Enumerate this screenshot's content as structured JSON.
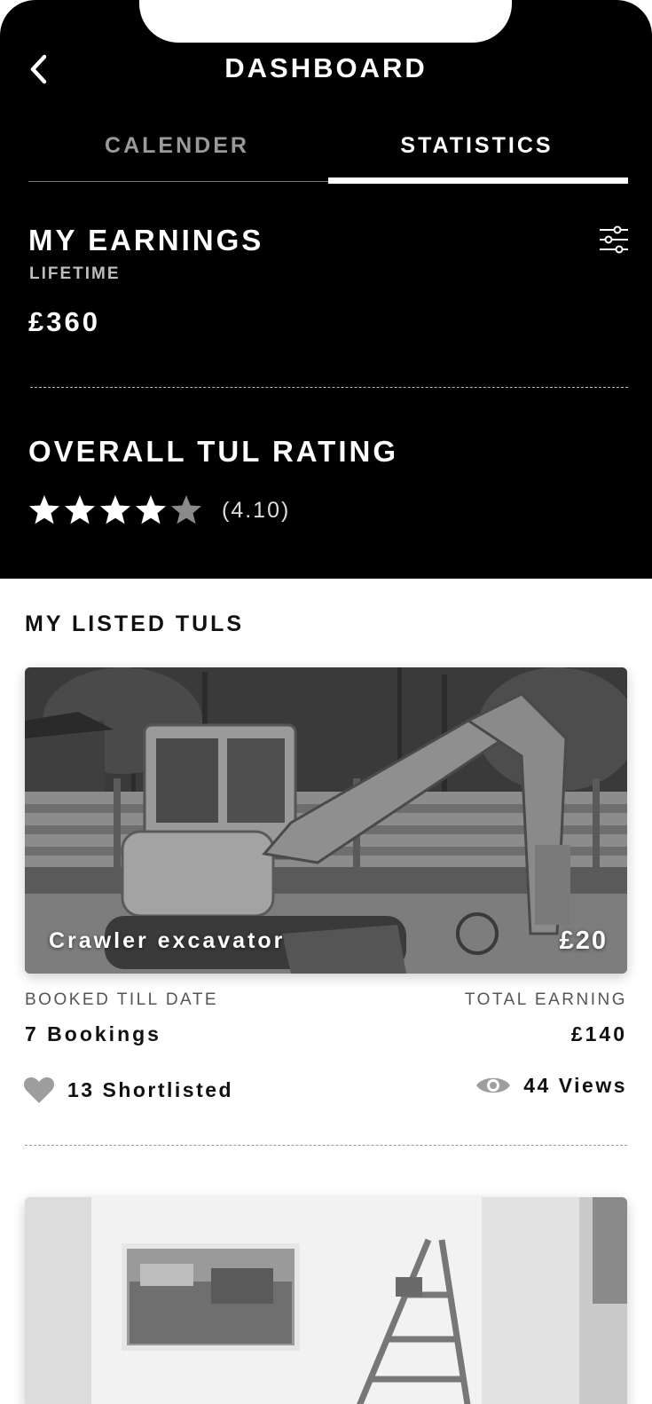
{
  "header": {
    "title": "DASHBOARD",
    "back_icon": "chevron-left-icon"
  },
  "tabs": [
    {
      "label": "CALENDER",
      "active": false
    },
    {
      "label": "STATISTICS",
      "active": true
    }
  ],
  "earnings": {
    "title": "MY EARNINGS",
    "period": "LIFETIME",
    "amount": "£360",
    "filter_icon": "sliders-icon"
  },
  "rating": {
    "title": "OVERALL TUL RATING",
    "value_text": "(4.10)",
    "stars_filled": 4,
    "stars_total": 5
  },
  "listings": {
    "title": "MY LISTED TULS",
    "items": [
      {
        "name": "Crawler excavator",
        "price": "£20",
        "booked_label": "BOOKED TILL DATE",
        "bookings": "7 Bookings",
        "earning_label": "TOTAL EARNING",
        "earning": "£140",
        "shortlisted": "13 Shortlisted",
        "views": "44 Views"
      }
    ]
  },
  "colors": {
    "header_bg": "#000000",
    "accent": "#ffffff",
    "muted_tab": "#9a9a9a",
    "heart": "#9e9e9e"
  }
}
